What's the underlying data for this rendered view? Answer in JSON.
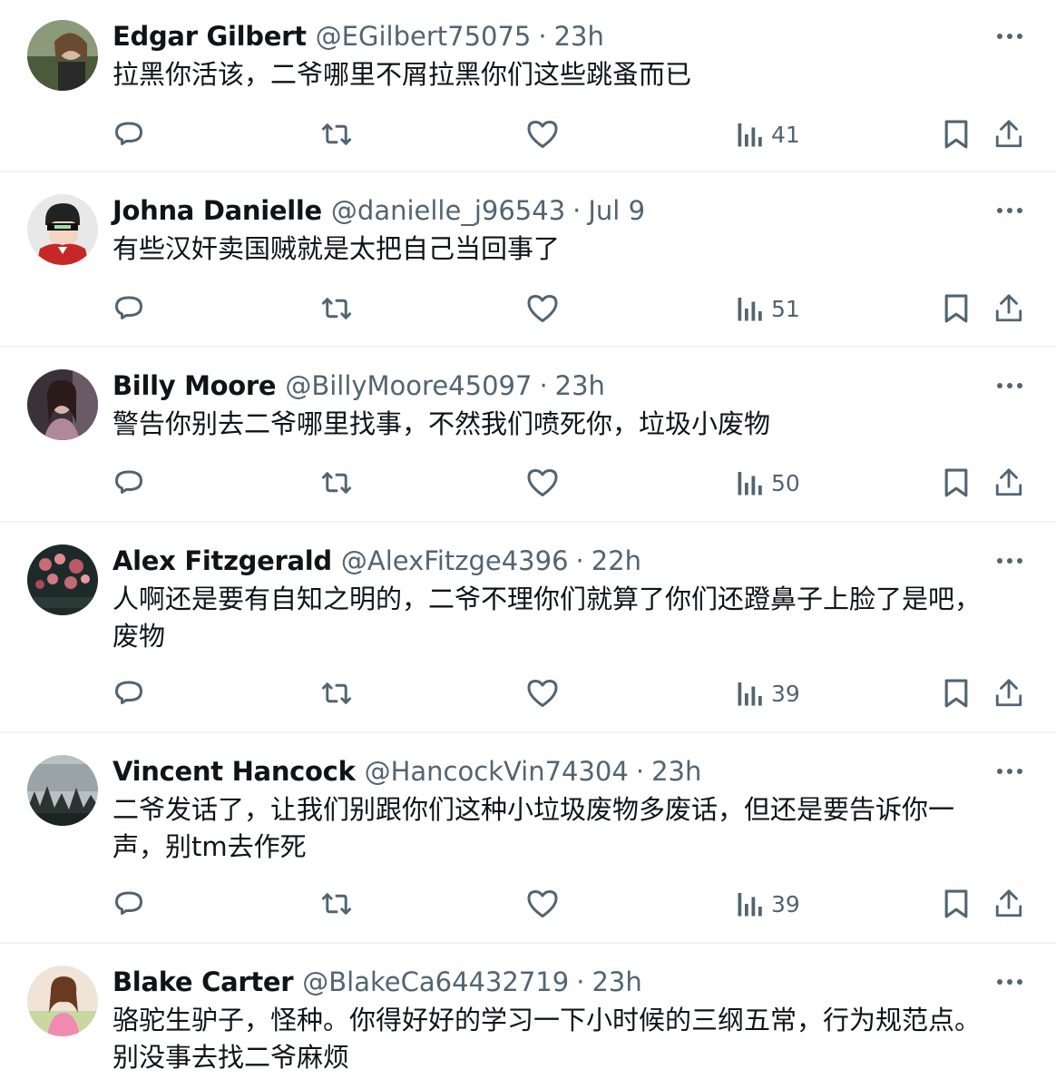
{
  "tweets": [
    {
      "name": "Edgar Gilbert",
      "handle": "@EGilbert75075",
      "separator": "·",
      "time": "23h",
      "text": "拉黑你活该，二爷哪里不屑拉黑你们这些跳蚤而已",
      "views": "41",
      "avatar_icon": "avatar-photo-woman"
    },
    {
      "name": "Johna Danielle",
      "handle": "@danielle_j96543",
      "separator": "·",
      "time": "Jul 9",
      "text": "有些汉奸卖国贼就是太把自己当回事了",
      "views": "51",
      "avatar_icon": "avatar-cartoon-man"
    },
    {
      "name": "Billy Moore",
      "handle": "@BillyMoore45097",
      "separator": "·",
      "time": "23h",
      "text": "警告你别去二爷哪里找事，不然我们喷死你，垃圾小废物",
      "views": "50",
      "avatar_icon": "avatar-photo-woman"
    },
    {
      "name": "Alex Fitzgerald",
      "handle": "@AlexFitzge4396",
      "separator": "·",
      "time": "22h",
      "text_lines": [
        "人啊还是要有自知之明的，二爷不理你们就算了你们还蹬鼻子上脸了是吧，",
        "废物"
      ],
      "views": "39",
      "avatar_icon": "avatar-photo-flowers"
    },
    {
      "name": "Vincent Hancock",
      "handle": "@HancockVin74304",
      "separator": "·",
      "time": "23h",
      "text_lines": [
        "二爷发话了，让我们别跟你们这种小垃圾废物多废话，但还是要告诉你一",
        "声，别tm去作死"
      ],
      "views": "39",
      "avatar_icon": "avatar-photo-forest"
    },
    {
      "name": "Blake Carter",
      "handle": "@BlakeCa64432719",
      "separator": "·",
      "time": "23h",
      "text_lines": [
        "骆驼生驴子，怪种。你得好好的学习一下小时候的三纲五常，行为规范点。",
        "别没事去找二爷麻烦"
      ],
      "avatar_icon": "avatar-photo-girl"
    }
  ],
  "colors": {
    "text_primary": "#0f1419",
    "text_secondary": "#536471",
    "divider": "#eff3f4"
  }
}
